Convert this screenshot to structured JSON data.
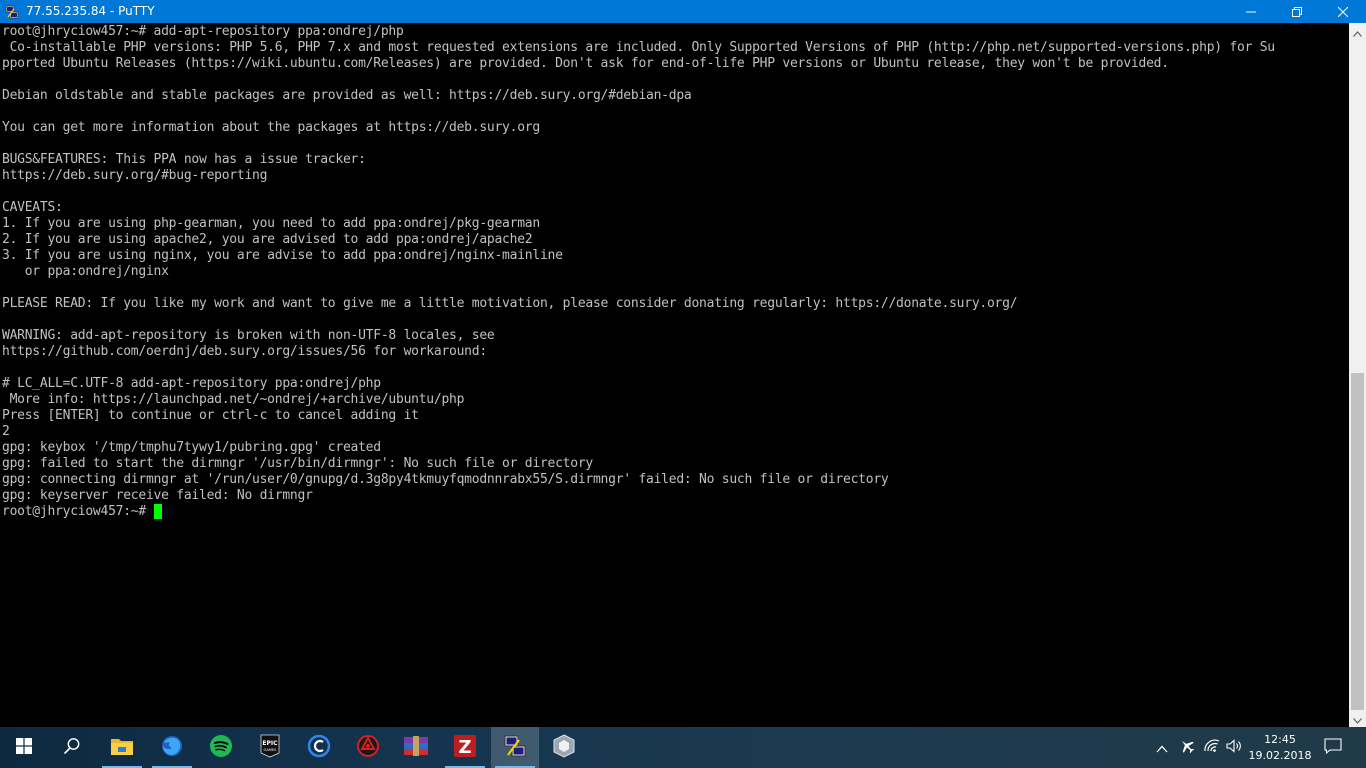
{
  "window": {
    "title": "77.55.235.84 - PuTTY",
    "icon": "putty-icon",
    "controls": [
      "minimize-icon",
      "restore-icon",
      "close-icon"
    ]
  },
  "terminal": {
    "lines": [
      "root@jhryciow457:~# add-apt-repository ppa:ondrej/php",
      " Co-installable PHP versions: PHP 5.6, PHP 7.x and most requested extensions are included. Only Supported Versions of PHP (http://php.net/supported-versions.php) for Su",
      "pported Ubuntu Releases (https://wiki.ubuntu.com/Releases) are provided. Don't ask for end-of-life PHP versions or Ubuntu release, they won't be provided.",
      "",
      "Debian oldstable and stable packages are provided as well: https://deb.sury.org/#debian-dpa",
      "",
      "You can get more information about the packages at https://deb.sury.org",
      "",
      "BUGS&FEATURES: This PPA now has a issue tracker:",
      "https://deb.sury.org/#bug-reporting",
      "",
      "CAVEATS:",
      "1. If you are using php-gearman, you need to add ppa:ondrej/pkg-gearman",
      "2. If you are using apache2, you are advised to add ppa:ondrej/apache2",
      "3. If you are using nginx, you are advise to add ppa:ondrej/nginx-mainline",
      "   or ppa:ondrej/nginx",
      "",
      "PLEASE READ: If you like my work and want to give me a little motivation, please consider donating regularly: https://donate.sury.org/",
      "",
      "WARNING: add-apt-repository is broken with non-UTF-8 locales, see",
      "https://github.com/oerdnj/deb.sury.org/issues/56 for workaround:",
      "",
      "# LC_ALL=C.UTF-8 add-apt-repository ppa:ondrej/php",
      " More info: https://launchpad.net/~ondrej/+archive/ubuntu/php",
      "Press [ENTER] to continue or ctrl-c to cancel adding it",
      "2",
      "gpg: keybox '/tmp/tmphu7tywy1/pubring.gpg' created",
      "gpg: failed to start the dirmngr '/usr/bin/dirmngr': No such file or directory",
      "gpg: connecting dirmngr at '/run/user/0/gnupg/d.3g8py4tkmuyfqmodnnrabx55/S.dirmngr' failed: No such file or directory",
      "gpg: keyserver receive failed: No dirmngr"
    ],
    "prompt": "root@jhryciow457:~#",
    "text_color": "#c0c0c0",
    "cursor_color": "#00ff00"
  },
  "taskbar": {
    "apps": [
      {
        "name": "windows-start-icon"
      },
      {
        "name": "search-icon"
      },
      {
        "name": "file-explorer-icon"
      },
      {
        "name": "firefox-icon"
      },
      {
        "name": "spotify-icon"
      },
      {
        "name": "epic-games-icon",
        "label": "EPIC GAMES"
      },
      {
        "name": "ccleaner-icon"
      },
      {
        "name": "antivirus-icon"
      },
      {
        "name": "winrar-icon"
      },
      {
        "name": "filezilla-icon"
      },
      {
        "name": "putty-icon"
      },
      {
        "name": "virtualbox-icon"
      }
    ],
    "tray": [
      "chevron-up-icon",
      "airplane-mode-icon",
      "wifi-icon",
      "volume-icon"
    ],
    "time": "12:45",
    "date": "19.02.2018",
    "notifications_icon": "notifications-icon"
  }
}
